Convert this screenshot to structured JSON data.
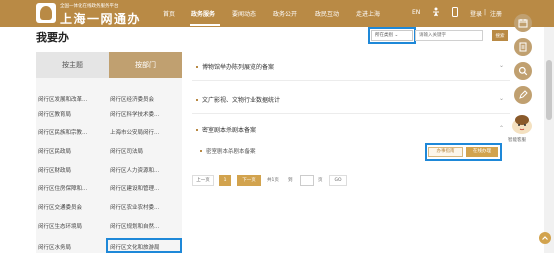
{
  "header": {
    "logo_sub": "全国一体化在线政务服务平台",
    "logo_title": "上海一网通办",
    "nav": [
      {
        "label": "首页",
        "active": false
      },
      {
        "label": "政务服务",
        "active": true
      },
      {
        "label": "要闻动态",
        "active": false
      },
      {
        "label": "政务公开",
        "active": false
      },
      {
        "label": "政民互动",
        "active": false
      },
      {
        "label": "走进上海",
        "active": false
      }
    ],
    "lang": "EN",
    "login": "登录",
    "register": "注册",
    "login_sep": "|"
  },
  "page": {
    "title": "我要办"
  },
  "search": {
    "category_selected": "所在类别",
    "placeholder": "请输入关键字",
    "button": "搜索"
  },
  "left": {
    "tabs": [
      {
        "label": "按主题",
        "active": false
      },
      {
        "label": "按部门",
        "active": true
      }
    ],
    "departments": [
      [
        "闵行区发展和改革...",
        "闵行区经济委员会"
      ],
      [
        "闵行区教育局",
        "闵行区科学技术委..."
      ],
      [
        "闵行区民族和宗教...",
        "上海市公安局闵行..."
      ],
      [
        "闵行区民政局",
        "闵行区司法局"
      ],
      [
        "闵行区财政局",
        "闵行区人力资源和..."
      ],
      [
        "闵行区住房保障和...",
        "闵行区建设和管理..."
      ],
      [
        "闵行区交通委员会",
        "闵行区农业农村委..."
      ],
      [
        "闵行区生态环境局",
        "闵行区规划和自然..."
      ],
      [
        "闵行区水务局",
        "闵行区文化和旅游局"
      ]
    ]
  },
  "services": [
    {
      "label": "博物馆举办陈列展览的备案"
    },
    {
      "label": "文广影视、文物行业数据统计"
    },
    {
      "label": "密室剧本杀剧本备案"
    }
  ],
  "sub_service": {
    "label": "密室剧本杀剧本备案",
    "guide_button": "办事指南",
    "apply_button": "在线办理"
  },
  "pagination": {
    "prev": "上一页",
    "current": "1",
    "next": "下一页",
    "total_text": "共1页",
    "goto_text": "到",
    "page_unit": "页",
    "go": "GO"
  },
  "floatbar": {
    "icons": [
      "calendar-icon",
      "document-icon",
      "search-icon",
      "edit-icon"
    ],
    "mascot_label": "智能客服"
  },
  "colors": {
    "brand": "#b98a45",
    "accent": "#d2a34e",
    "highlight": "#1e88d8"
  }
}
